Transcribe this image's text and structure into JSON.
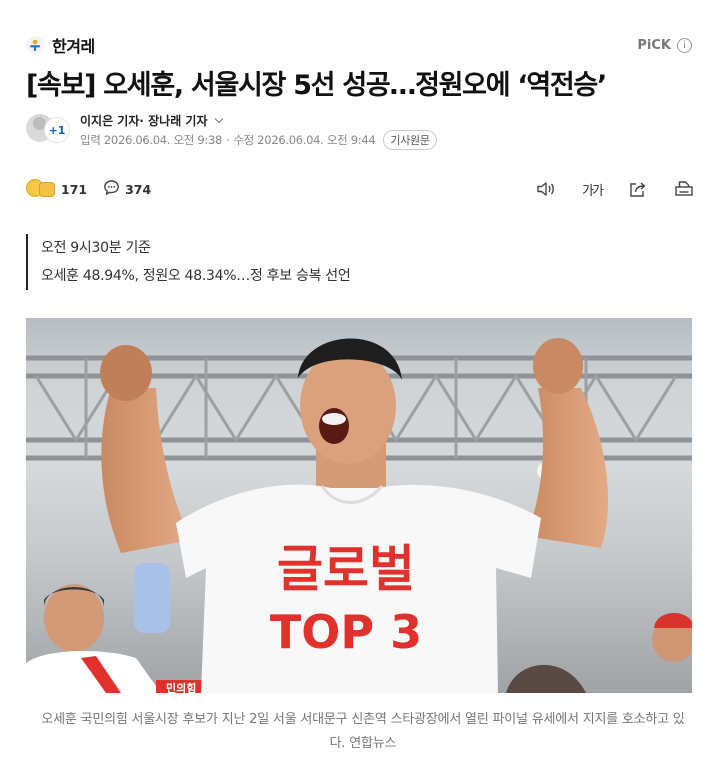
{
  "press": {
    "name": "한겨레",
    "logo_icon": "hankyoreh-logo-icon"
  },
  "pick": {
    "label": "PiCK",
    "info_icon": "info-icon"
  },
  "article": {
    "headline": "[속보] 오세훈, 서울시장 5선 성공…정원오에 ‘역전승’",
    "reporters": "이지은 기자· 장나래 기자",
    "extra_reporters": "+1",
    "published": "입력 2026.06.04. 오전 9:38",
    "modified": "수정 2026.06.04. 오전 9:44",
    "original_link": "기사원문"
  },
  "actions": {
    "reaction_count": "171",
    "comment_count": "374",
    "tools": [
      "speaker-icon",
      "font-size-icon",
      "share-icon",
      "print-icon"
    ],
    "font_size_label": "가가"
  },
  "summary": [
    "오전 9시30분 기준",
    "오세훈 48.94%, 정원오 48.34%…정 후보 승복 선언"
  ],
  "photo": {
    "shirt_text_line1": "글로벌",
    "shirt_text_line2": "TOP 3",
    "background_text": "민의힘",
    "caption": "오세훈 국민의힘 서울시장 후보가 지난 2일 서울 서대문구 신촌역 스타광장에서 열린 파이널 유세에서 지지를 호소하고 있다. 연합뉴스"
  },
  "colors": {
    "accent_blue": "#0b61c1",
    "shirt_red": "#e0312c",
    "text_gray": "#888888"
  }
}
